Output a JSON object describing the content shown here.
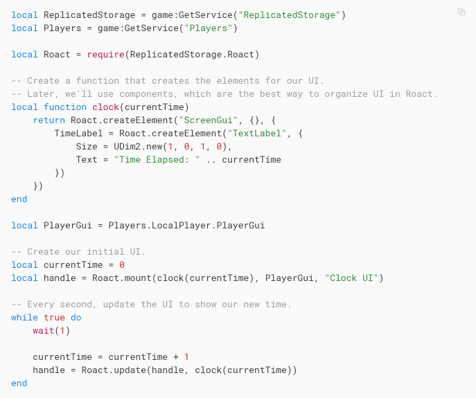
{
  "language": "lua",
  "copy_button": {
    "title": "Copy"
  },
  "tokens": [
    [
      [
        "kw",
        "local"
      ],
      [
        "id",
        " ReplicatedStorage "
      ],
      [
        "id",
        "="
      ],
      [
        "id",
        " game"
      ],
      [
        "id",
        ":GetService("
      ],
      [
        "str",
        "\"ReplicatedStorage\""
      ],
      [
        "id",
        ")"
      ]
    ],
    [
      [
        "kw",
        "local"
      ],
      [
        "id",
        " Players "
      ],
      [
        "id",
        "="
      ],
      [
        "id",
        " game"
      ],
      [
        "id",
        ":GetService("
      ],
      [
        "str",
        "\"Players\""
      ],
      [
        "id",
        ")"
      ]
    ],
    [],
    [
      [
        "kw",
        "local"
      ],
      [
        "id",
        " Roact "
      ],
      [
        "id",
        "="
      ],
      [
        "id",
        " "
      ],
      [
        "fn",
        "require"
      ],
      [
        "id",
        "(ReplicatedStorage.Roact)"
      ]
    ],
    [],
    [
      [
        "com",
        "-- Create a function that creates the elements for our UI."
      ]
    ],
    [
      [
        "com",
        "-- Later, we'll use components, which are the best way to organize UI in Roact."
      ]
    ],
    [
      [
        "kw",
        "local"
      ],
      [
        "id",
        " "
      ],
      [
        "kw",
        "function"
      ],
      [
        "id",
        " "
      ],
      [
        "fn",
        "clock"
      ],
      [
        "id",
        "(currentTime)"
      ]
    ],
    [
      [
        "id",
        "    "
      ],
      [
        "kw",
        "return"
      ],
      [
        "id",
        " Roact.createElement("
      ],
      [
        "str",
        "\"ScreenGui\""
      ],
      [
        "id",
        ", {}, {"
      ]
    ],
    [
      [
        "id",
        "        TimeLabel = Roact.createElement("
      ],
      [
        "str",
        "\"TextLabel\""
      ],
      [
        "id",
        ", {"
      ]
    ],
    [
      [
        "id",
        "            Size = UDim2.new("
      ],
      [
        "num",
        "1"
      ],
      [
        "id",
        ", "
      ],
      [
        "num",
        "0"
      ],
      [
        "id",
        ", "
      ],
      [
        "num",
        "1"
      ],
      [
        "id",
        ", "
      ],
      [
        "num",
        "0"
      ],
      [
        "id",
        "),"
      ]
    ],
    [
      [
        "id",
        "            Text = "
      ],
      [
        "str",
        "\"Time Elapsed: \""
      ],
      [
        "id",
        " .. currentTime"
      ]
    ],
    [
      [
        "id",
        "        })"
      ]
    ],
    [
      [
        "id",
        "    })"
      ]
    ],
    [
      [
        "kw",
        "end"
      ]
    ],
    [],
    [
      [
        "kw",
        "local"
      ],
      [
        "id",
        " PlayerGui "
      ],
      [
        "id",
        "="
      ],
      [
        "id",
        " Players.LocalPlayer.PlayerGui"
      ]
    ],
    [],
    [
      [
        "com",
        "-- Create our initial UI."
      ]
    ],
    [
      [
        "kw",
        "local"
      ],
      [
        "id",
        " currentTime "
      ],
      [
        "id",
        "="
      ],
      [
        "id",
        " "
      ],
      [
        "num",
        "0"
      ]
    ],
    [
      [
        "kw",
        "local"
      ],
      [
        "id",
        " handle "
      ],
      [
        "id",
        "="
      ],
      [
        "id",
        " Roact.mount(clock(currentTime), PlayerGui, "
      ],
      [
        "str",
        "\"Clock UI\""
      ],
      [
        "id",
        ")"
      ]
    ],
    [],
    [
      [
        "com",
        "-- Every second, update the UI to show our new time."
      ]
    ],
    [
      [
        "kw",
        "while"
      ],
      [
        "id",
        " "
      ],
      [
        "num",
        "true"
      ],
      [
        "id",
        " "
      ],
      [
        "kw",
        "do"
      ]
    ],
    [
      [
        "id",
        "    "
      ],
      [
        "fn",
        "wait"
      ],
      [
        "id",
        "("
      ],
      [
        "num",
        "1"
      ],
      [
        "id",
        ")"
      ]
    ],
    [],
    [
      [
        "id",
        "    currentTime = currentTime + "
      ],
      [
        "num",
        "1"
      ]
    ],
    [
      [
        "id",
        "    handle = Roact.update(handle, clock(currentTime))"
      ]
    ],
    [
      [
        "kw",
        "end"
      ]
    ]
  ]
}
